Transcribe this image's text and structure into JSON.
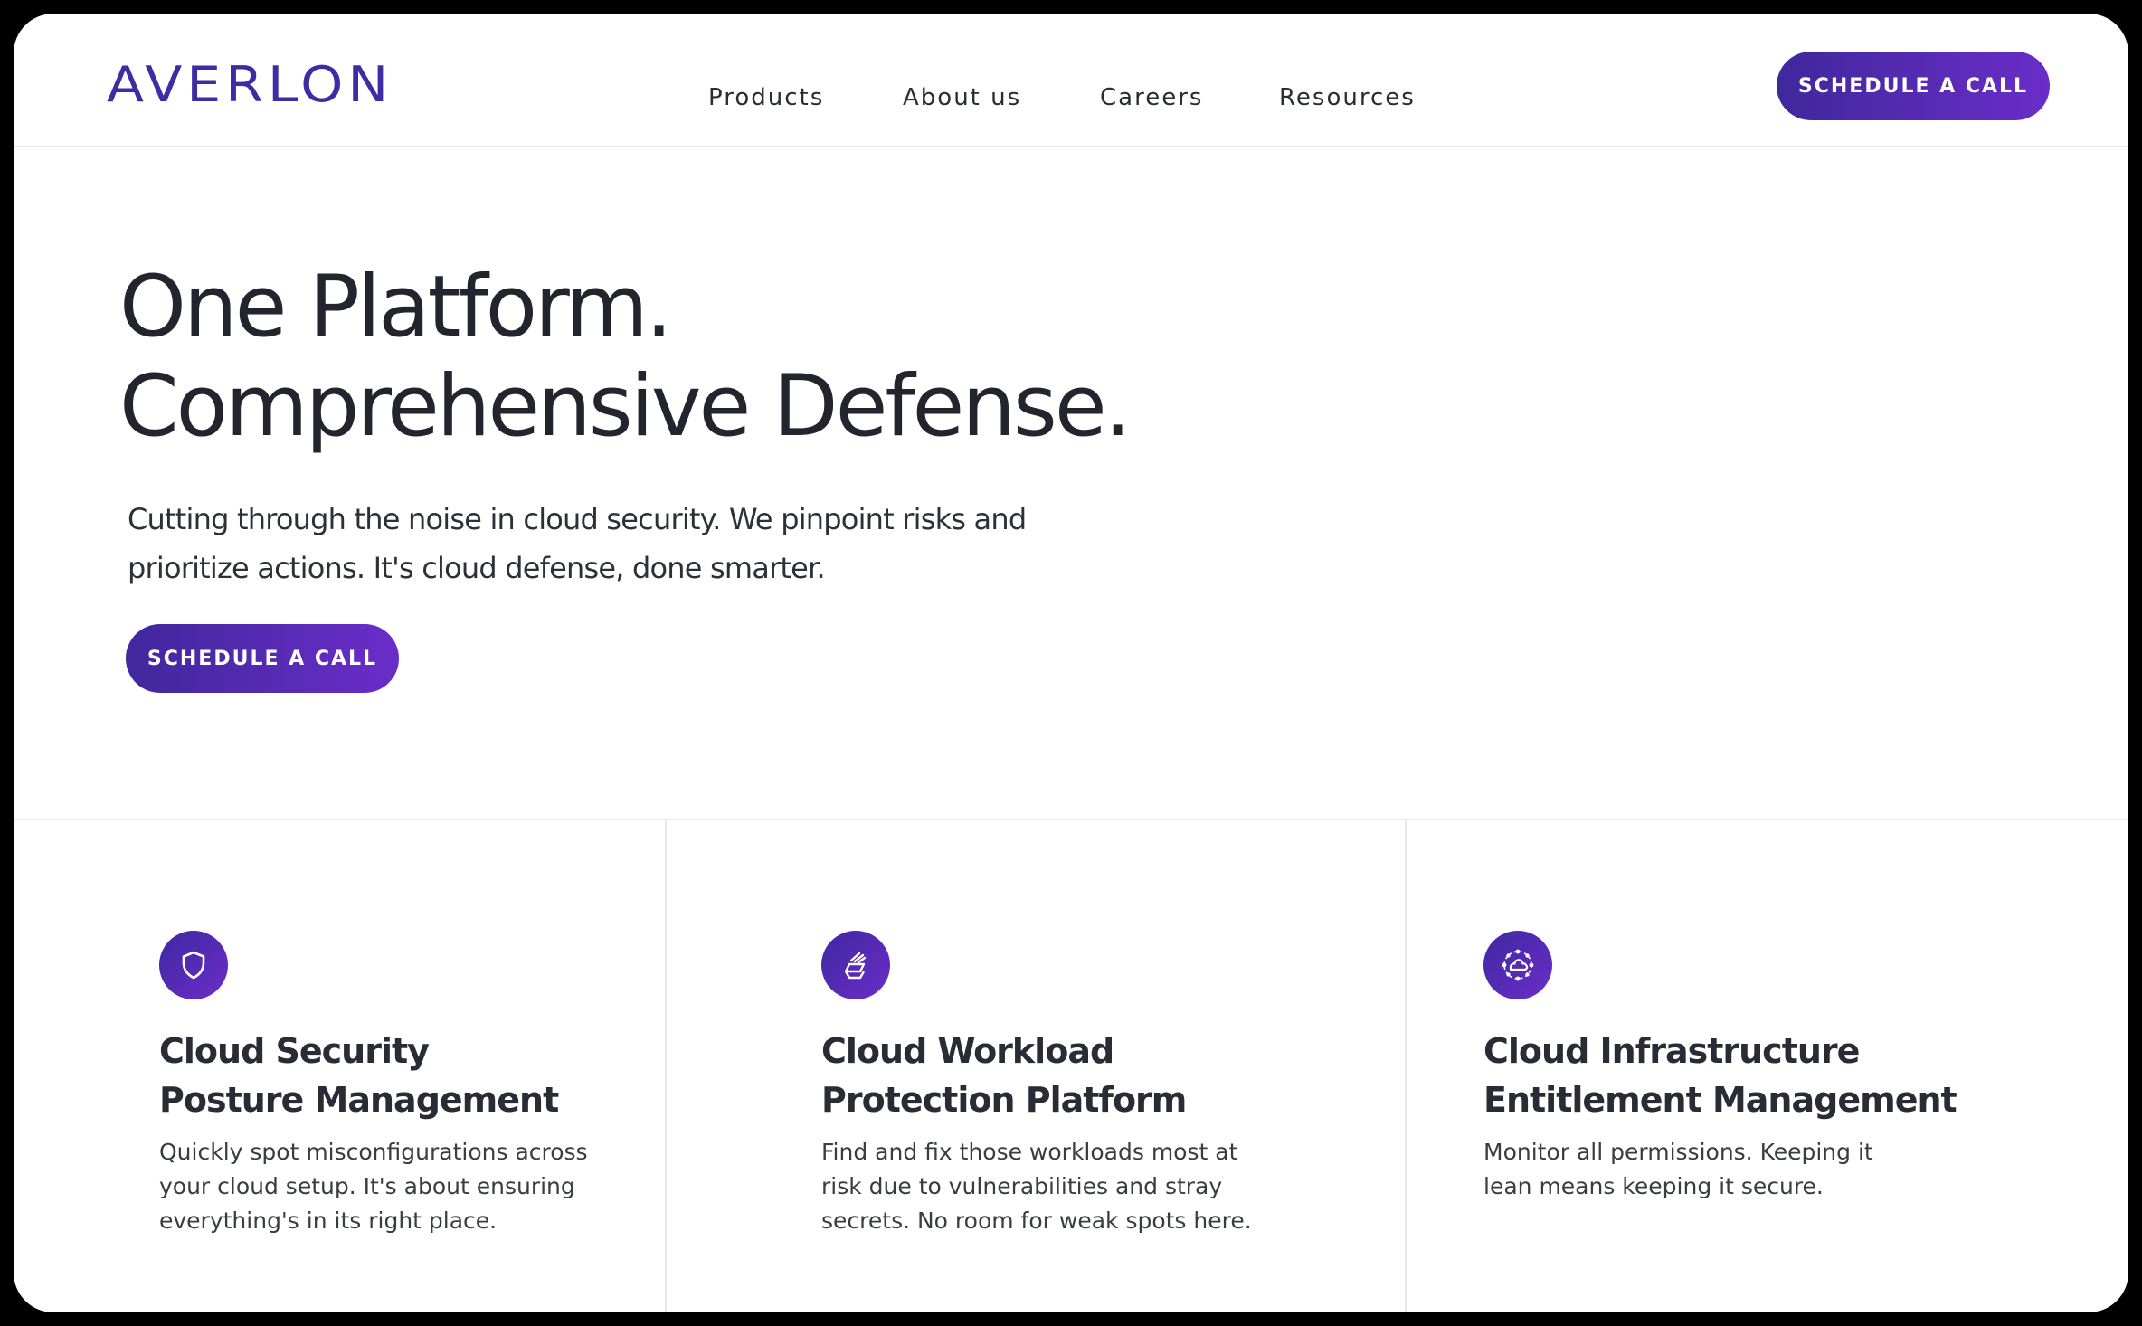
{
  "brand": {
    "logo": "AVERLON"
  },
  "nav": {
    "items": [
      {
        "label": "Products"
      },
      {
        "label": "About us"
      },
      {
        "label": "Careers"
      },
      {
        "label": "Resources"
      }
    ],
    "cta_label": "SCHEDULE A CALL"
  },
  "hero": {
    "title_line1": "One Platform.",
    "title_line2": "Comprehensive Defense.",
    "subtitle_line1": "Cutting through the noise in cloud security. We pinpoint risks and",
    "subtitle_line2": "prioritize actions. It's cloud defense, done smarter.",
    "cta_label": "SCHEDULE A CALL"
  },
  "features": [
    {
      "icon": "shield-icon",
      "title_line1": "Cloud Security",
      "title_line2": "Posture Management",
      "text": "Quickly spot misconfigurations across your cloud setup. It's about ensuring everything's in its right place."
    },
    {
      "icon": "layers-icon",
      "title_line1": "Cloud Workload",
      "title_line2": "Protection Platform",
      "text": "Find and fix those workloads most at risk due to vulnerabilities and stray secrets. No room for weak spots here."
    },
    {
      "icon": "cloud-network-icon",
      "title_line1": "Cloud Infrastructure",
      "title_line2": "Entitlement Management",
      "text": "Monitor all permissions. Keeping it lean means keeping it secure."
    }
  ],
  "colors": {
    "accent_start": "#40289c",
    "accent_end": "#6a2dc8",
    "logo": "#3f2ba4",
    "text": "#23252e"
  }
}
